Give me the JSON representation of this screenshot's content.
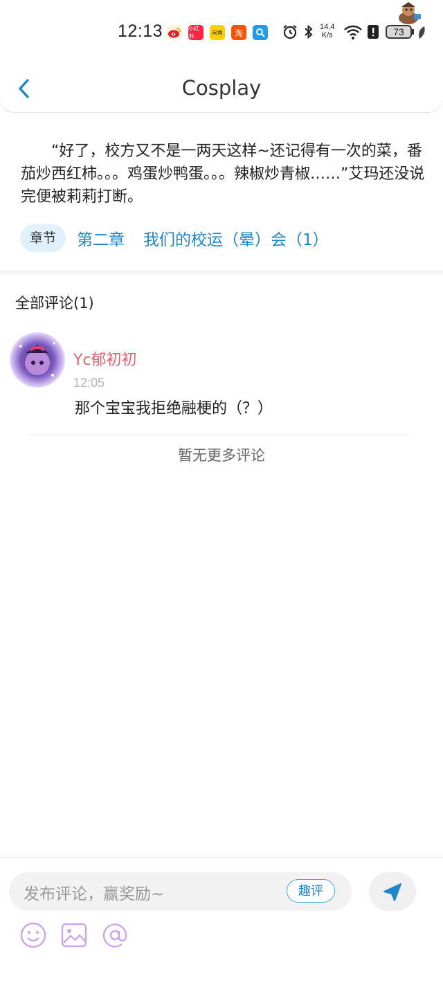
{
  "status_bar": {
    "time": "12:13",
    "app_icons": [
      {
        "name": "weibo-icon",
        "color": "#f6c33c",
        "label": ""
      },
      {
        "name": "xiaohongshu-icon",
        "color": "#ff2442",
        "label": "小红书"
      },
      {
        "name": "meituan-icon",
        "color": "#ffcf00",
        "label": "闲鱼"
      },
      {
        "name": "taobao-icon",
        "color": "#ff5000",
        "label": "淘"
      },
      {
        "name": "search-app-icon",
        "color": "#1e9bf0",
        "label": ""
      }
    ],
    "net_speed_value": "14.4",
    "net_speed_unit": "K/s",
    "battery": "73"
  },
  "header": {
    "title": "Cosplay"
  },
  "excerpt": {
    "text": "“好了，校方又不是一两天这样~还记得有一次的菜，番茄炒西红柿。。。鸡蛋炒鸭蛋。。。辣椒炒青椒……”艾玛还没说完便被莉莉打断。"
  },
  "chapter": {
    "tag": "章节",
    "number": "第二章",
    "name": "我们的校运（晕）会（1）"
  },
  "comments": {
    "heading": "全部评论(1)",
    "items": [
      {
        "user": "Yc郁初初",
        "time": "12:05",
        "text": "那个宝宝我拒绝融梗的（？）"
      }
    ],
    "no_more": "暂无更多评论"
  },
  "composer": {
    "placeholder": "发布评论，赢奖励~",
    "fun_button": "趣评",
    "colors": {
      "accent": "#1d87c9",
      "icon": "#c9a6f0"
    }
  }
}
